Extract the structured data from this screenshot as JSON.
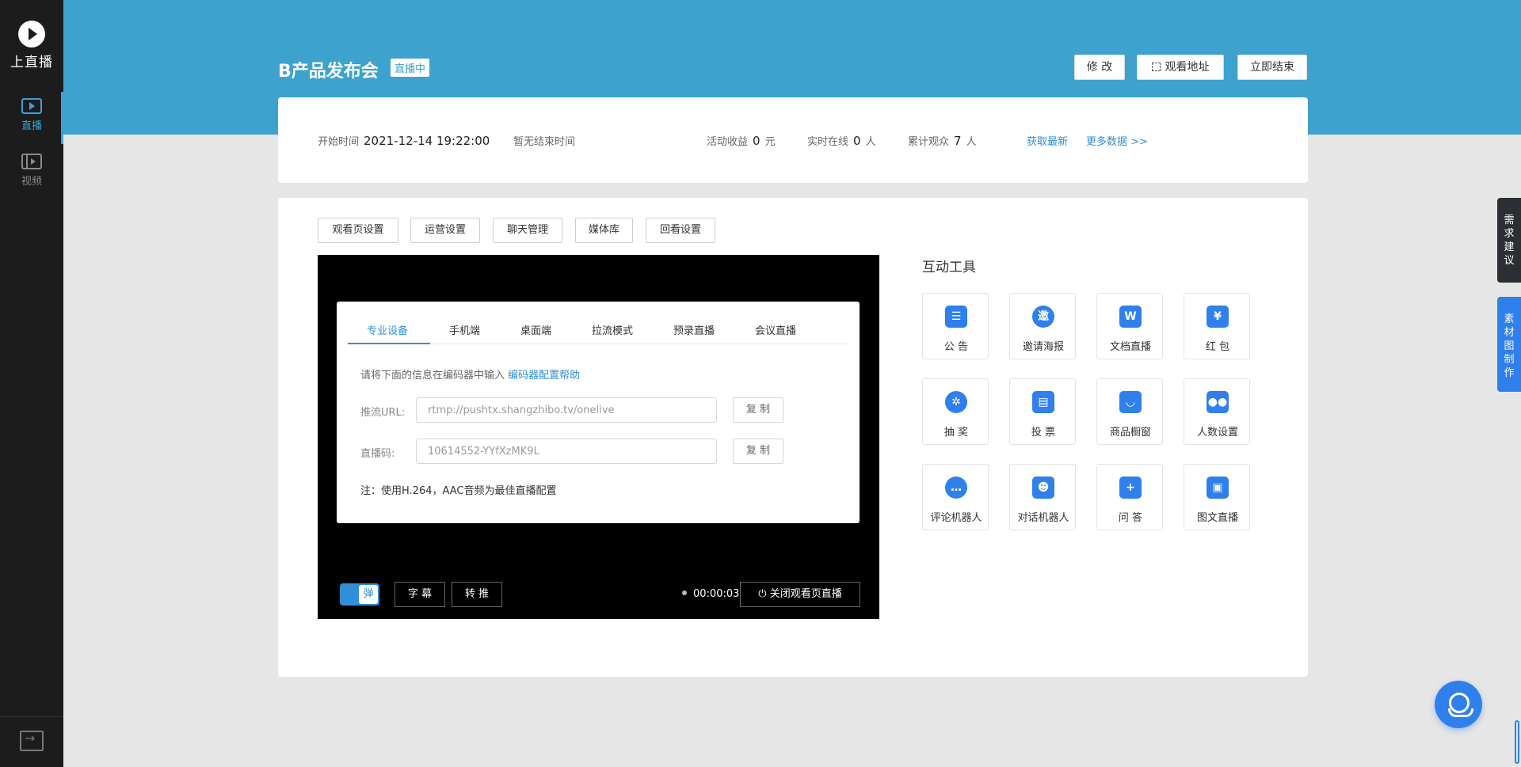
{
  "brand": {
    "name": "上直播"
  },
  "sidebar": {
    "items": [
      {
        "label": "直播"
      },
      {
        "label": "视频"
      }
    ]
  },
  "header": {
    "title": "B产品发布会",
    "status_badge": "直播中",
    "buttons": {
      "edit": "修 改",
      "watch_url": "观看地址",
      "end_now": "立即结束"
    }
  },
  "stats": {
    "start_label": "开始时间",
    "start_value": "2021-12-14 19:22:00",
    "end_text": "暂无结束时间",
    "revenue_label": "活动收益",
    "revenue_value": "0",
    "revenue_unit": "元",
    "online_label": "实时在线",
    "online_value": "0",
    "online_unit": "人",
    "total_label": "累计观众",
    "total_value": "7",
    "total_unit": "人",
    "refresh": "获取最新",
    "more": "更多数据 >>"
  },
  "settings_tabs": [
    "观看页设置",
    "运营设置",
    "聊天管理",
    "媒体库",
    "回看设置"
  ],
  "push_panel": {
    "tabs": [
      "专业设备",
      "手机端",
      "桌面端",
      "拉流模式",
      "预录直播",
      "会议直播"
    ],
    "info": "请将下面的信息在编码器中输入",
    "help_link": "编码器配置帮助",
    "url_label": "推流URL:",
    "url_value": "rtmp://pushtx.shangzhibo.tv/onelive",
    "code_label": "直播码:",
    "code_value": "10614552-YYfXzMK9L",
    "copy": "复 制",
    "note": "注：使用H.264，AAC音频为最佳直播配置"
  },
  "player": {
    "danmaku": "弹",
    "subtitle": "字 幕",
    "relay": "转 推",
    "timer": "00:00:03",
    "close_watch": "关闭观看页直播"
  },
  "tools": {
    "title": "互动工具",
    "items": [
      {
        "label": "公 告",
        "icon": "announcement-icon",
        "glyph": "☰"
      },
      {
        "label": "邀请海报",
        "icon": "invite-poster-icon",
        "glyph": "邀"
      },
      {
        "label": "文档直播",
        "icon": "document-icon",
        "glyph": "W"
      },
      {
        "label": "红 包",
        "icon": "red-packet-icon",
        "glyph": "¥"
      },
      {
        "label": "抽 奖",
        "icon": "lottery-wheel-icon",
        "glyph": "✲"
      },
      {
        "label": "投 票",
        "icon": "vote-icon",
        "glyph": "▤"
      },
      {
        "label": "商品橱窗",
        "icon": "shopping-bag-icon",
        "glyph": "◡"
      },
      {
        "label": "人数设置",
        "icon": "users-icon",
        "glyph": "●●"
      },
      {
        "label": "评论机器人",
        "icon": "comment-bot-icon",
        "glyph": "…"
      },
      {
        "label": "对话机器人",
        "icon": "chat-bot-icon",
        "glyph": "☻"
      },
      {
        "label": "问 答",
        "icon": "qa-icon",
        "glyph": "+"
      },
      {
        "label": "图文直播",
        "icon": "image-text-icon",
        "glyph": "▣"
      }
    ]
  },
  "float_tabs": {
    "feedback": "需求建议",
    "material": "素材图制作"
  },
  "colors": {
    "header": "#3da2ce",
    "accent": "#2f80ed",
    "link": "#2f8fd8",
    "sidebar": "#1c1c1c"
  }
}
